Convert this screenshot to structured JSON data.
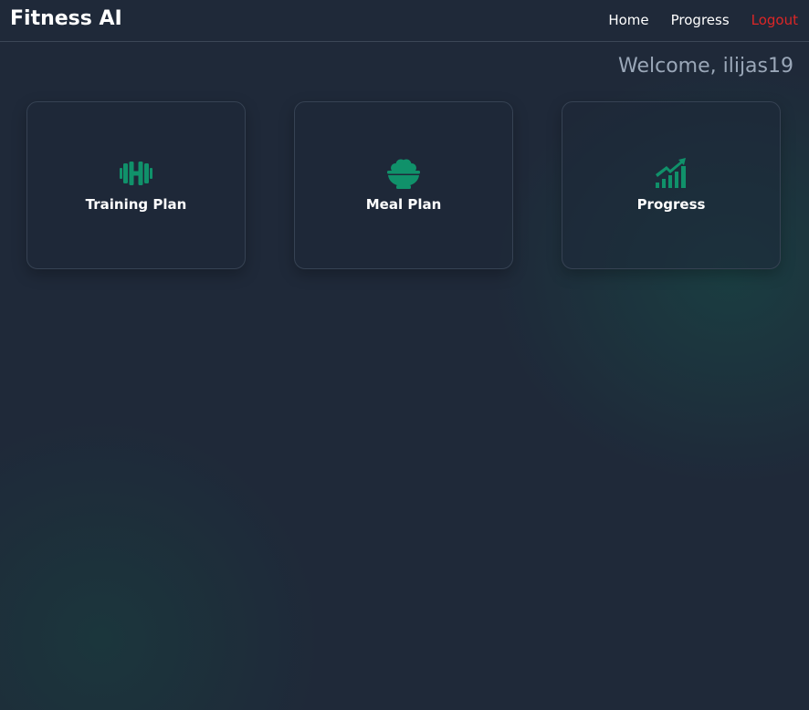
{
  "app": {
    "brand": "Fitness AI"
  },
  "nav": {
    "home": "Home",
    "progress": "Progress",
    "logout": "Logout"
  },
  "welcome": "Welcome, ilijas19",
  "cards": [
    {
      "label": "Training Plan",
      "icon": "dumbbell-icon"
    },
    {
      "label": "Meal Plan",
      "icon": "bowl-food-icon"
    },
    {
      "label": "Progress",
      "icon": "chart-growth-icon"
    }
  ],
  "colors": {
    "background": "#1f2939",
    "accent": "#10916a",
    "logout": "#dc2626",
    "welcome_text": "#9aa7b8"
  }
}
